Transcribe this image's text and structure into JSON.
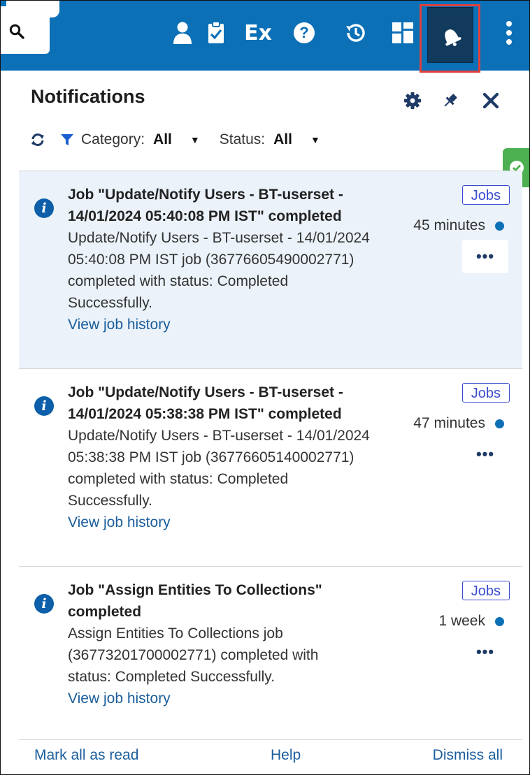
{
  "header": {
    "title": "Notifications",
    "filters": {
      "category_label": "Category:",
      "category_value": "All",
      "status_label": "Status:",
      "status_value": "All"
    }
  },
  "toolbar_icons": [
    "search-icon",
    "user-icon",
    "tasks-icon",
    "ex-icon",
    "help-icon",
    "history-icon",
    "dashboard-icon",
    "bell-icon",
    "more-vertical-icon"
  ],
  "toolbar": {
    "ex_label": "Ex",
    "help_label": "?"
  },
  "notifications": [
    {
      "title": "Job \"Update/Notify Users - BT-userset - 14/01/2024 05:40:08 PM IST\" completed",
      "body": "Update/Notify Users - BT-userset - 14/01/2024 05:40:08 PM IST job (36776605490002771) completed with status: Completed Successfully.",
      "link": "View job history",
      "tag": "Jobs",
      "time": "45 minutes",
      "unread": true,
      "more_label": "•••"
    },
    {
      "title": "Job \"Update/Notify Users - BT-userset - 14/01/2024 05:38:38 PM IST\" completed",
      "body": "Update/Notify Users - BT-userset - 14/01/2024 05:38:38 PM IST job (36776605140002771) completed with status: Completed Successfully.",
      "link": "View job history",
      "tag": "Jobs",
      "time": "47 minutes",
      "unread": true,
      "more_label": "•••"
    },
    {
      "title": "Job \"Assign Entities To Collections\" completed",
      "body": "Assign Entities To Collections job (36773201700002771) completed with status: Completed Successfully.",
      "link": "View job history",
      "tag": "Jobs",
      "time": "1 week",
      "unread": true,
      "more_label": "•••"
    }
  ],
  "footer": {
    "mark_all_read": "Mark all as read",
    "help": "Help",
    "dismiss_all": "Dismiss all"
  },
  "colors": {
    "topbar": "#0c70b7",
    "accent": "#1a5d9c",
    "highlight": "#e0403d",
    "toast": "#4caf50",
    "unread_bg": "#ebf2f9"
  }
}
